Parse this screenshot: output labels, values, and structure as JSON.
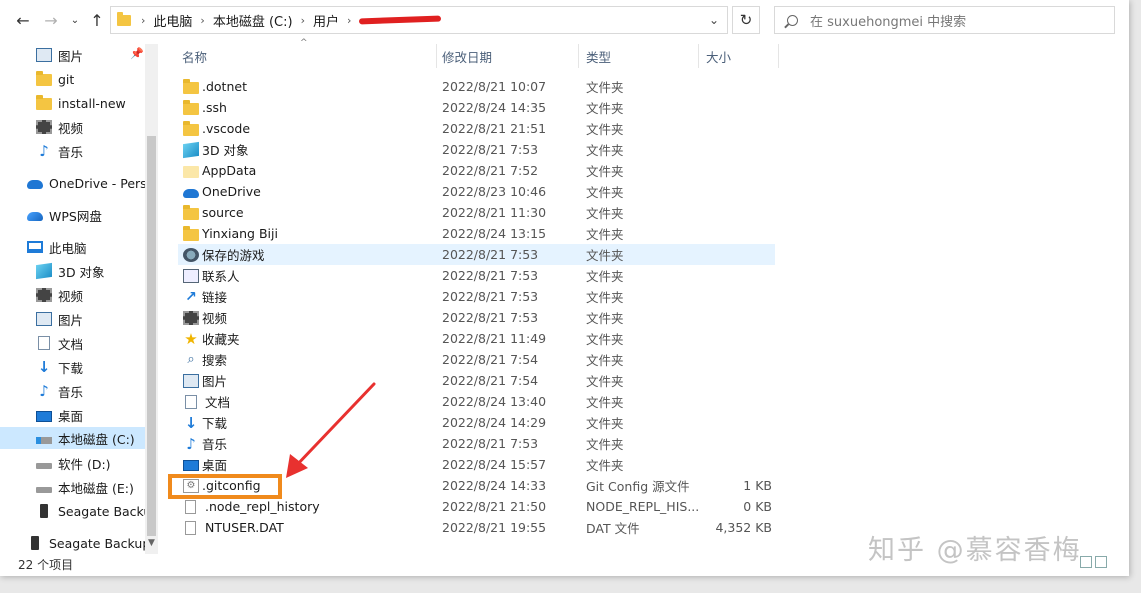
{
  "breadcrumb": [
    "此电脑",
    "本地磁盘 (C:)",
    "用户"
  ],
  "search_placeholder": "在 suxuehongmei 中搜索",
  "columns": {
    "name": "名称",
    "date": "修改日期",
    "type": "类型",
    "size": "大小"
  },
  "sidebar": [
    {
      "label": "图片",
      "icon": "picture-icon"
    },
    {
      "label": "git",
      "icon": "folder-icon"
    },
    {
      "label": "install-new",
      "icon": "folder-icon"
    },
    {
      "label": "视频",
      "icon": "video-icon"
    },
    {
      "label": "音乐",
      "icon": "music-icon"
    },
    {
      "label": "OneDrive - Perso",
      "icon": "onedrive-icon"
    },
    {
      "label": "WPS网盘",
      "icon": "wps-cloud-icon"
    },
    {
      "label": "此电脑",
      "icon": "this-pc-icon"
    },
    {
      "label": "3D 对象",
      "icon": "3d-objects-icon"
    },
    {
      "label": "视频",
      "icon": "video-icon"
    },
    {
      "label": "图片",
      "icon": "picture-icon"
    },
    {
      "label": "文档",
      "icon": "document-icon"
    },
    {
      "label": "下载",
      "icon": "download-icon"
    },
    {
      "label": "音乐",
      "icon": "music-icon"
    },
    {
      "label": "桌面",
      "icon": "desktop-icon"
    },
    {
      "label": "本地磁盘 (C:)",
      "icon": "drive-c-icon"
    },
    {
      "label": "软件 (D:)",
      "icon": "drive-icon"
    },
    {
      "label": "本地磁盘 (E:)",
      "icon": "drive-icon"
    },
    {
      "label": "Seagate Backu",
      "icon": "external-drive-icon"
    },
    {
      "label": "Seagate Backup",
      "icon": "external-drive-icon"
    }
  ],
  "files": [
    {
      "name": ".dotnet",
      "date": "2022/8/21 10:07",
      "type": "文件夹",
      "size": "",
      "icon": "folder-icon"
    },
    {
      "name": ".ssh",
      "date": "2022/8/24 14:35",
      "type": "文件夹",
      "size": "",
      "icon": "folder-icon"
    },
    {
      "name": ".vscode",
      "date": "2022/8/21 21:51",
      "type": "文件夹",
      "size": "",
      "icon": "folder-icon"
    },
    {
      "name": "3D 对象",
      "date": "2022/8/21 7:53",
      "type": "文件夹",
      "size": "",
      "icon": "3d-objects-icon"
    },
    {
      "name": "AppData",
      "date": "2022/8/21 7:52",
      "type": "文件夹",
      "size": "",
      "icon": "hidden-folder-icon"
    },
    {
      "name": "OneDrive",
      "date": "2022/8/23 10:46",
      "type": "文件夹",
      "size": "",
      "icon": "onedrive-icon"
    },
    {
      "name": "source",
      "date": "2022/8/21 11:30",
      "type": "文件夹",
      "size": "",
      "icon": "folder-icon"
    },
    {
      "name": "Yinxiang Biji",
      "date": "2022/8/24 13:15",
      "type": "文件夹",
      "size": "",
      "icon": "folder-icon"
    },
    {
      "name": "保存的游戏",
      "date": "2022/8/21 7:53",
      "type": "文件夹",
      "size": "",
      "icon": "saved-games-icon"
    },
    {
      "name": "联系人",
      "date": "2022/8/21 7:53",
      "type": "文件夹",
      "size": "",
      "icon": "contacts-icon"
    },
    {
      "name": "链接",
      "date": "2022/8/21 7:53",
      "type": "文件夹",
      "size": "",
      "icon": "links-icon"
    },
    {
      "name": "视频",
      "date": "2022/8/21 7:53",
      "type": "文件夹",
      "size": "",
      "icon": "video-icon"
    },
    {
      "name": "收藏夹",
      "date": "2022/8/21 11:49",
      "type": "文件夹",
      "size": "",
      "icon": "favorites-icon"
    },
    {
      "name": "搜索",
      "date": "2022/8/21 7:54",
      "type": "文件夹",
      "size": "",
      "icon": "searches-icon"
    },
    {
      "name": "图片",
      "date": "2022/8/21 7:54",
      "type": "文件夹",
      "size": "",
      "icon": "picture-icon"
    },
    {
      "name": "文档",
      "date": "2022/8/24 13:40",
      "type": "文件夹",
      "size": "",
      "icon": "document-icon"
    },
    {
      "name": "下载",
      "date": "2022/8/24 14:29",
      "type": "文件夹",
      "size": "",
      "icon": "download-icon"
    },
    {
      "name": "音乐",
      "date": "2022/8/21 7:53",
      "type": "文件夹",
      "size": "",
      "icon": "music-icon"
    },
    {
      "name": "桌面",
      "date": "2022/8/24 15:57",
      "type": "文件夹",
      "size": "",
      "icon": "desktop-icon"
    },
    {
      "name": ".gitconfig",
      "date": "2022/8/24 14:33",
      "type": "Git Config 源文件",
      "size": "1 KB",
      "icon": "config-file-icon"
    },
    {
      "name": ".node_repl_history",
      "date": "2022/8/21 21:50",
      "type": "NODE_REPL_HIS...",
      "size": "0 KB",
      "icon": "file-icon"
    },
    {
      "name": "NTUSER.DAT",
      "date": "2022/8/21 19:55",
      "type": "DAT 文件",
      "size": "4,352 KB",
      "icon": "file-icon"
    }
  ],
  "status": "22 个项目",
  "watermark": "知乎 @慕容香梅",
  "colors": {
    "highlight_box": "#f08a1c",
    "arrow": "#e8312f",
    "redaction": "#e02020",
    "selection": "#cce8ff"
  }
}
